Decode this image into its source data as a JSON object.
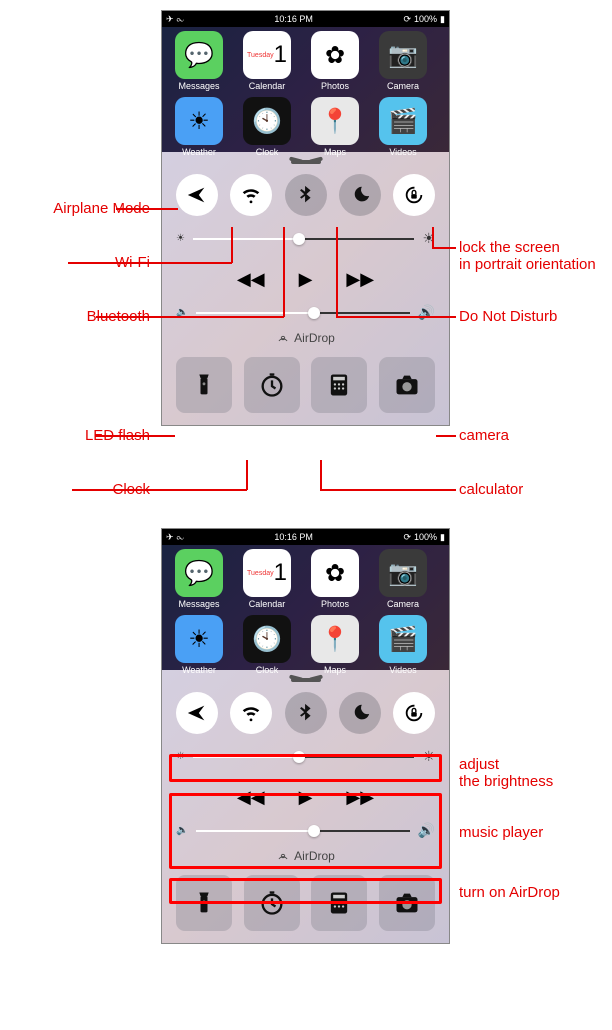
{
  "status": {
    "time": "10:16 PM",
    "battery": "100%"
  },
  "apps": [
    {
      "label": "Messages",
      "bg": "#5bd060",
      "glyph": "💬"
    },
    {
      "label": "Calendar",
      "bg": "#ffffff",
      "glyph": "1",
      "sub": "Tuesday"
    },
    {
      "label": "Photos",
      "bg": "#ffffff",
      "glyph": "✿"
    },
    {
      "label": "Camera",
      "bg": "#3a3a3a",
      "glyph": "📷"
    },
    {
      "label": "Weather",
      "bg": "#4aa0f5",
      "glyph": "☀"
    },
    {
      "label": "Clock",
      "bg": "#111111",
      "glyph": "🕙"
    },
    {
      "label": "Maps",
      "bg": "#e8e8e8",
      "glyph": "📍"
    },
    {
      "label": "Videos",
      "bg": "#55c3ed",
      "glyph": "🎬"
    }
  ],
  "toggles": [
    {
      "name": "airplane",
      "on": true,
      "svg": "plane"
    },
    {
      "name": "wifi",
      "on": true,
      "svg": "wifi"
    },
    {
      "name": "bluetooth",
      "on": false,
      "svg": "bt"
    },
    {
      "name": "dnd",
      "on": false,
      "svg": "moon"
    },
    {
      "name": "rotation-lock",
      "on": true,
      "svg": "lock"
    }
  ],
  "brightness_pct": 48,
  "volume_pct": 55,
  "airdrop_label": "AirDrop",
  "shortcuts": [
    {
      "name": "flashlight",
      "svg": "torch"
    },
    {
      "name": "clock",
      "svg": "timer"
    },
    {
      "name": "calculator",
      "svg": "calc"
    },
    {
      "name": "camera",
      "svg": "cam"
    }
  ],
  "callouts_top": {
    "airplane": "Airplane Mode",
    "wifi": "Wi-Fi",
    "bluetooth": "Bluetooth",
    "rotation": "lock the screen\nin portrait orientation",
    "dnd": "Do Not Disturb",
    "flash": "LED flash",
    "clock": "Clock",
    "camera": "camera",
    "calculator": "calculator"
  },
  "callouts_bottom": {
    "brightness": "adjust\nthe brightness",
    "music": "music player",
    "airdrop": "turn on AirDrop"
  }
}
